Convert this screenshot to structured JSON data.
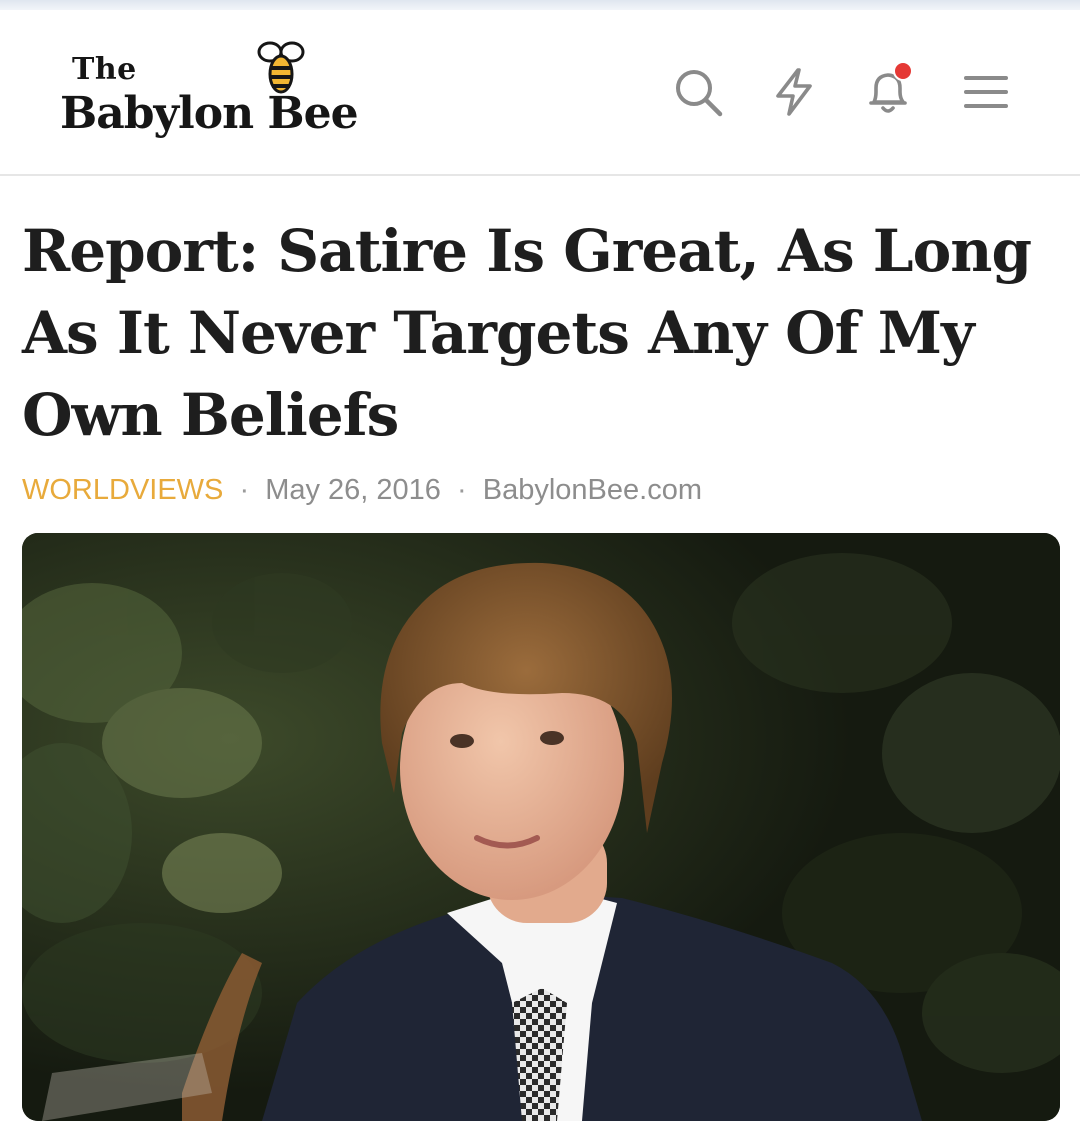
{
  "header": {
    "logo": {
      "line1": "The",
      "line2": "Babylon Bee",
      "icon": "bee-logo-icon"
    },
    "actions": [
      {
        "name": "search",
        "icon": "search-icon"
      },
      {
        "name": "trending",
        "icon": "lightning-icon"
      },
      {
        "name": "notifications",
        "icon": "bell-icon",
        "badge_color": "#e53935"
      },
      {
        "name": "menu",
        "icon": "hamburger-menu-icon"
      }
    ]
  },
  "article": {
    "title": "Report: Satire Is Great, As Long As It Never Targets Any Of My Own Beliefs",
    "category": "WORLDVIEWS",
    "date": "May 26, 2016",
    "source": "BabylonBee.com",
    "separator": "·"
  },
  "colors": {
    "accent": "#e8aa3b",
    "title": "#1e1e1e",
    "meta": "#8d8d8d",
    "icon": "#8a8a8a",
    "badge": "#e53935"
  }
}
